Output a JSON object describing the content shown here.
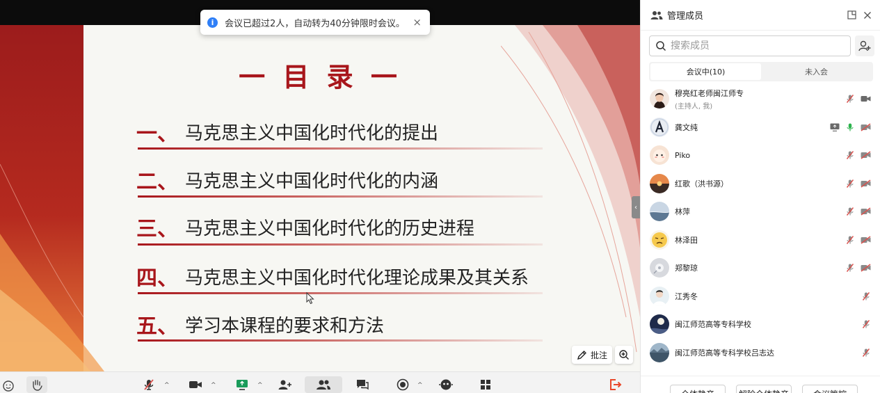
{
  "toast": {
    "message": "会议已超过2人，自动转为40分钟限时会议。",
    "close": "×"
  },
  "slide": {
    "title": "一 目 录 一",
    "items": [
      {
        "num": "一、",
        "text": "马克思主义中国化时代化的提出"
      },
      {
        "num": "二、",
        "text": "马克思主义中国化时代化的内涵"
      },
      {
        "num": "三、",
        "text": "马克思主义中国化时代化的历史进程"
      },
      {
        "num": "四、",
        "text": "马克思主义中国化时代化理论成果及其关系"
      },
      {
        "num": "五、",
        "text": "学习本课程的要求和方法"
      }
    ]
  },
  "annotate": {
    "label": "批注"
  },
  "panel": {
    "title": "管理成员",
    "search_placeholder": "搜索成员",
    "tabs": [
      {
        "label": "会议中(10)"
      },
      {
        "label": "未入会"
      }
    ],
    "members": [
      {
        "name": "穆亮红老师闽江师专",
        "role": "(主持人, 我)",
        "avatar": "photo-woman",
        "mic": "muted",
        "video": "on",
        "share": false
      },
      {
        "name": "龚文纯",
        "role": "",
        "avatar": "letter-a",
        "mic": "on",
        "video": "off",
        "share": true
      },
      {
        "name": "Piko",
        "role": "",
        "avatar": "cartoon",
        "mic": "muted",
        "video": "off",
        "share": false
      },
      {
        "name": "红歌（洪书源）",
        "role": "",
        "avatar": "sunset",
        "mic": "muted",
        "video": "off",
        "share": false
      },
      {
        "name": "林萍",
        "role": "",
        "avatar": "sea",
        "mic": "muted",
        "video": "off",
        "share": false
      },
      {
        "name": "林泽田",
        "role": "",
        "avatar": "emoji",
        "mic": "muted",
        "video": "off",
        "share": false
      },
      {
        "name": "郑黎琼",
        "role": "",
        "avatar": "flower",
        "mic": "muted",
        "video": "off",
        "share": false
      },
      {
        "name": "江秀冬",
        "role": "",
        "avatar": "person",
        "mic": "muted",
        "video": "none",
        "share": false
      },
      {
        "name": "闽江师范高等专科学校",
        "role": "",
        "avatar": "moon",
        "mic": "muted",
        "video": "none",
        "share": false
      },
      {
        "name": "闽江师范高等专科学校吕志达",
        "role": "",
        "avatar": "lake",
        "mic": "muted",
        "video": "none",
        "share": false
      }
    ],
    "footer": {
      "mute_all": "全体静音",
      "unmute_all": "解除全体静音",
      "meeting_control": "会议管控"
    }
  },
  "colors": {
    "slide_red": "#a8161b",
    "mic_on": "#2bb24c",
    "muted_red": "#d9534f",
    "leave_red": "#e8472b",
    "share_green": "#1a9b5a"
  }
}
